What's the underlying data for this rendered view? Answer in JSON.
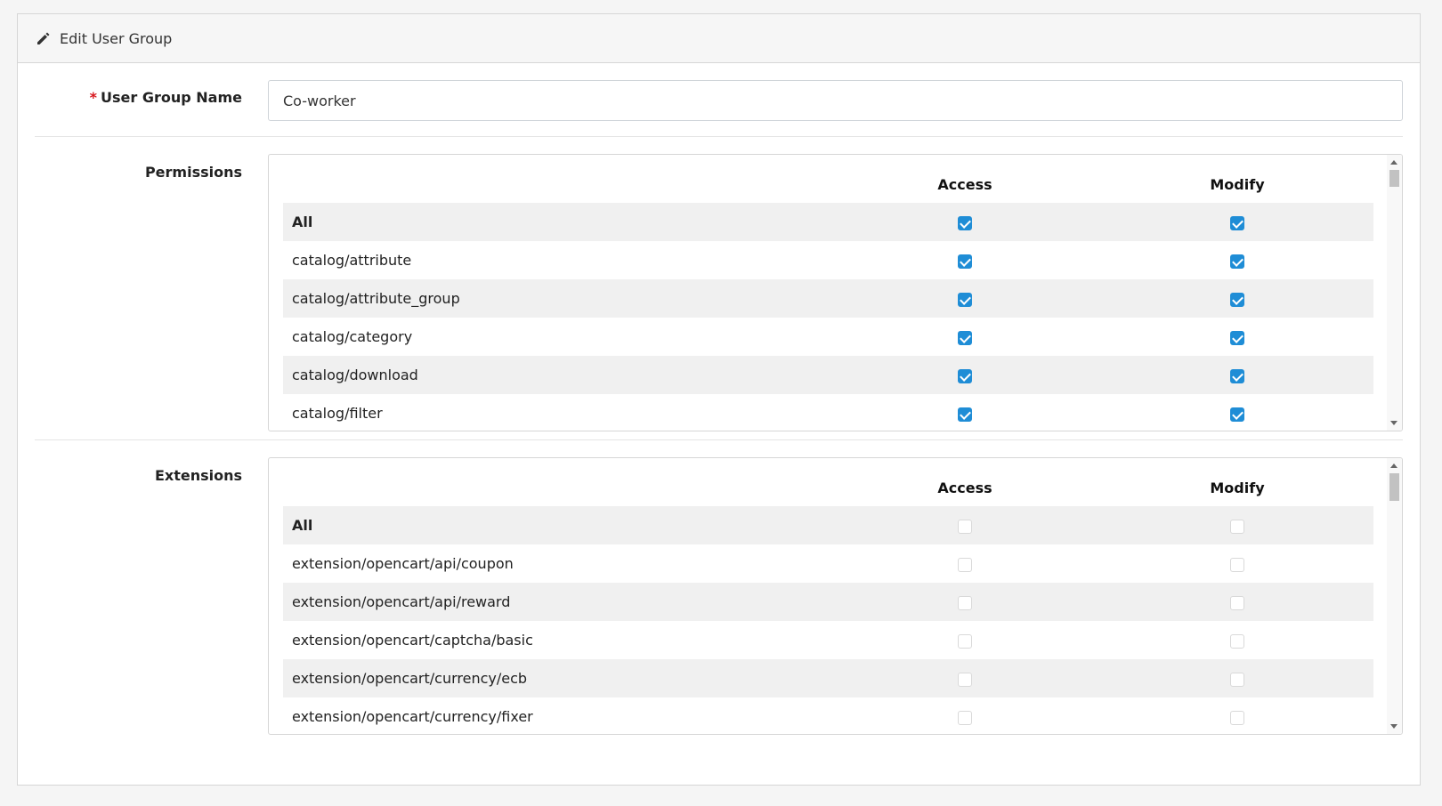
{
  "header": {
    "title": "Edit User Group",
    "icon": "pencil-icon"
  },
  "form": {
    "name_label": "User Group Name",
    "required_mark": "*",
    "name_value": "Co-worker",
    "permissions_label": "Permissions",
    "extensions_label": "Extensions"
  },
  "permissions": {
    "col_access": "Access",
    "col_modify": "Modify",
    "rows": [
      {
        "name": "All",
        "access": true,
        "modify": true
      },
      {
        "name": "catalog/attribute",
        "access": true,
        "modify": true
      },
      {
        "name": "catalog/attribute_group",
        "access": true,
        "modify": true
      },
      {
        "name": "catalog/category",
        "access": true,
        "modify": true
      },
      {
        "name": "catalog/download",
        "access": true,
        "modify": true
      },
      {
        "name": "catalog/filter",
        "access": true,
        "modify": true
      }
    ]
  },
  "extensions": {
    "col_access": "Access",
    "col_modify": "Modify",
    "rows": [
      {
        "name": "All",
        "access": false,
        "modify": false
      },
      {
        "name": "extension/opencart/api/coupon",
        "access": false,
        "modify": false
      },
      {
        "name": "extension/opencart/api/reward",
        "access": false,
        "modify": false
      },
      {
        "name": "extension/opencart/captcha/basic",
        "access": false,
        "modify": false
      },
      {
        "name": "extension/opencart/currency/ecb",
        "access": false,
        "modify": false
      },
      {
        "name": "extension/opencart/currency/fixer",
        "access": false,
        "modify": false
      }
    ]
  },
  "colors": {
    "checkbox_checked": "#1f8dd6",
    "required": "#d7141a",
    "stripe": "#f0f0f0"
  }
}
